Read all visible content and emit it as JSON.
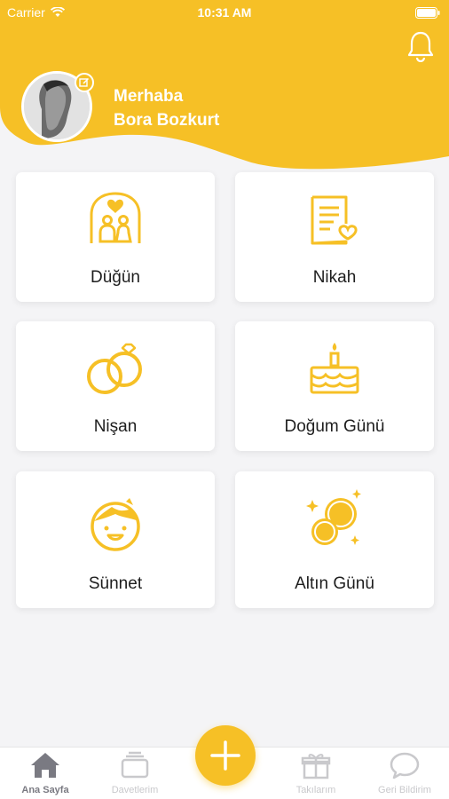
{
  "status_bar": {
    "carrier": "Carrier",
    "time": "10:31 AM"
  },
  "header": {
    "greeting_line1": "Merhaba",
    "greeting_line2": "Bora Bozkurt",
    "accent_color": "#f6c026"
  },
  "categories": [
    {
      "label": "Düğün",
      "icon": "wedding-couple-icon"
    },
    {
      "label": "Nikah",
      "icon": "marriage-certificate-icon"
    },
    {
      "label": "Nişan",
      "icon": "engagement-rings-icon"
    },
    {
      "label": "Doğum Günü",
      "icon": "birthday-cake-icon"
    },
    {
      "label": "Sünnet",
      "icon": "boy-face-icon"
    },
    {
      "label": "Altın Günü",
      "icon": "gold-coins-icon"
    }
  ],
  "tabbar": {
    "tabs": [
      {
        "label": "Ana Sayfa",
        "icon": "home-icon",
        "active": true
      },
      {
        "label": "Davetlerim",
        "icon": "invitations-icon",
        "active": false
      },
      {
        "label": "Takılarım",
        "icon": "gift-icon",
        "active": false
      },
      {
        "label": "Geri Bildirim",
        "icon": "chat-bubble-icon",
        "active": false
      }
    ],
    "fab_icon": "plus-icon"
  }
}
